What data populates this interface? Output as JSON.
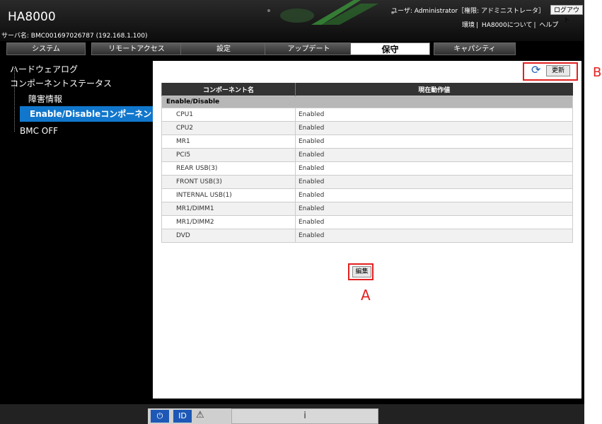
{
  "header": {
    "app_title": "HA8000",
    "server_info": "サーバ名: BMC001697026787 (192.168.1.100)",
    "user_info": "ユーザ: Administrator［権限: アドミニストレータ］",
    "logout_label": "ログアウト",
    "links": [
      "環境",
      "HA8000について",
      "ヘルプ"
    ]
  },
  "tabs": [
    {
      "label": "システム",
      "active": false
    },
    {
      "label": "リモートアクセス",
      "active": false
    },
    {
      "label": "設定",
      "active": false
    },
    {
      "label": "アップデート",
      "active": false
    },
    {
      "label": "保守",
      "active": true
    },
    {
      "label": "キャパシティ",
      "active": false
    }
  ],
  "sidebar": {
    "hardware_log": "ハードウェアログ",
    "component_status": "コンポーネントステータス",
    "fault_info": "障害情報",
    "enable_disable": "Enable/Disableコンポーネント",
    "bmc_off": "BMC OFF"
  },
  "main": {
    "refresh_label": "更新",
    "edit_label": "編集",
    "table": {
      "headers": [
        "コンポーネント名",
        "現在動作値"
      ],
      "group": "Enable/Disable",
      "rows": [
        {
          "name": "CPU1",
          "value": "Enabled"
        },
        {
          "name": "CPU2",
          "value": "Enabled"
        },
        {
          "name": "MR1",
          "value": "Enabled"
        },
        {
          "name": "PCI5",
          "value": "Enabled"
        },
        {
          "name": "REAR USB(3)",
          "value": "Enabled"
        },
        {
          "name": "FRONT USB(3)",
          "value": "Enabled"
        },
        {
          "name": "INTERNAL USB(1)",
          "value": "Enabled"
        },
        {
          "name": "MR1/DIMM1",
          "value": "Enabled"
        },
        {
          "name": "MR1/DIMM2",
          "value": "Enabled"
        },
        {
          "name": "DVD",
          "value": "Enabled"
        }
      ]
    }
  },
  "annotations": {
    "a": "A",
    "b": "B"
  },
  "footer": {
    "power_icon": "power-icon",
    "id_icon": "id-icon",
    "alert_icon": "alert-icon",
    "status_text": "i"
  },
  "colors": {
    "accent": "#1177cc",
    "annotation": "#e32020"
  }
}
